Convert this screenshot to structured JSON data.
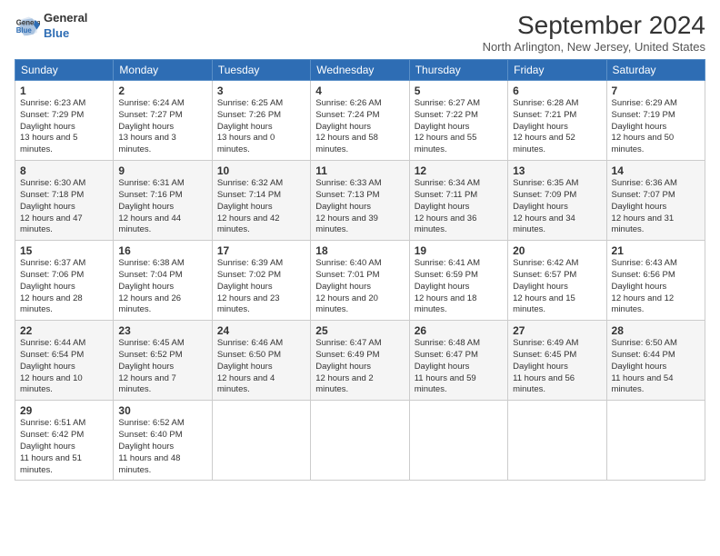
{
  "header": {
    "logo_line1": "General",
    "logo_line2": "Blue",
    "month": "September 2024",
    "location": "North Arlington, New Jersey, United States"
  },
  "days_of_week": [
    "Sunday",
    "Monday",
    "Tuesday",
    "Wednesday",
    "Thursday",
    "Friday",
    "Saturday"
  ],
  "weeks": [
    [
      {
        "day": "1",
        "sunrise": "6:23 AM",
        "sunset": "7:29 PM",
        "daylight": "13 hours and 5 minutes."
      },
      {
        "day": "2",
        "sunrise": "6:24 AM",
        "sunset": "7:27 PM",
        "daylight": "13 hours and 3 minutes."
      },
      {
        "day": "3",
        "sunrise": "6:25 AM",
        "sunset": "7:26 PM",
        "daylight": "13 hours and 0 minutes."
      },
      {
        "day": "4",
        "sunrise": "6:26 AM",
        "sunset": "7:24 PM",
        "daylight": "12 hours and 58 minutes."
      },
      {
        "day": "5",
        "sunrise": "6:27 AM",
        "sunset": "7:22 PM",
        "daylight": "12 hours and 55 minutes."
      },
      {
        "day": "6",
        "sunrise": "6:28 AM",
        "sunset": "7:21 PM",
        "daylight": "12 hours and 52 minutes."
      },
      {
        "day": "7",
        "sunrise": "6:29 AM",
        "sunset": "7:19 PM",
        "daylight": "12 hours and 50 minutes."
      }
    ],
    [
      {
        "day": "8",
        "sunrise": "6:30 AM",
        "sunset": "7:18 PM",
        "daylight": "12 hours and 47 minutes."
      },
      {
        "day": "9",
        "sunrise": "6:31 AM",
        "sunset": "7:16 PM",
        "daylight": "12 hours and 44 minutes."
      },
      {
        "day": "10",
        "sunrise": "6:32 AM",
        "sunset": "7:14 PM",
        "daylight": "12 hours and 42 minutes."
      },
      {
        "day": "11",
        "sunrise": "6:33 AM",
        "sunset": "7:13 PM",
        "daylight": "12 hours and 39 minutes."
      },
      {
        "day": "12",
        "sunrise": "6:34 AM",
        "sunset": "7:11 PM",
        "daylight": "12 hours and 36 minutes."
      },
      {
        "day": "13",
        "sunrise": "6:35 AM",
        "sunset": "7:09 PM",
        "daylight": "12 hours and 34 minutes."
      },
      {
        "day": "14",
        "sunrise": "6:36 AM",
        "sunset": "7:07 PM",
        "daylight": "12 hours and 31 minutes."
      }
    ],
    [
      {
        "day": "15",
        "sunrise": "6:37 AM",
        "sunset": "7:06 PM",
        "daylight": "12 hours and 28 minutes."
      },
      {
        "day": "16",
        "sunrise": "6:38 AM",
        "sunset": "7:04 PM",
        "daylight": "12 hours and 26 minutes."
      },
      {
        "day": "17",
        "sunrise": "6:39 AM",
        "sunset": "7:02 PM",
        "daylight": "12 hours and 23 minutes."
      },
      {
        "day": "18",
        "sunrise": "6:40 AM",
        "sunset": "7:01 PM",
        "daylight": "12 hours and 20 minutes."
      },
      {
        "day": "19",
        "sunrise": "6:41 AM",
        "sunset": "6:59 PM",
        "daylight": "12 hours and 18 minutes."
      },
      {
        "day": "20",
        "sunrise": "6:42 AM",
        "sunset": "6:57 PM",
        "daylight": "12 hours and 15 minutes."
      },
      {
        "day": "21",
        "sunrise": "6:43 AM",
        "sunset": "6:56 PM",
        "daylight": "12 hours and 12 minutes."
      }
    ],
    [
      {
        "day": "22",
        "sunrise": "6:44 AM",
        "sunset": "6:54 PM",
        "daylight": "12 hours and 10 minutes."
      },
      {
        "day": "23",
        "sunrise": "6:45 AM",
        "sunset": "6:52 PM",
        "daylight": "12 hours and 7 minutes."
      },
      {
        "day": "24",
        "sunrise": "6:46 AM",
        "sunset": "6:50 PM",
        "daylight": "12 hours and 4 minutes."
      },
      {
        "day": "25",
        "sunrise": "6:47 AM",
        "sunset": "6:49 PM",
        "daylight": "12 hours and 2 minutes."
      },
      {
        "day": "26",
        "sunrise": "6:48 AM",
        "sunset": "6:47 PM",
        "daylight": "11 hours and 59 minutes."
      },
      {
        "day": "27",
        "sunrise": "6:49 AM",
        "sunset": "6:45 PM",
        "daylight": "11 hours and 56 minutes."
      },
      {
        "day": "28",
        "sunrise": "6:50 AM",
        "sunset": "6:44 PM",
        "daylight": "11 hours and 54 minutes."
      }
    ],
    [
      {
        "day": "29",
        "sunrise": "6:51 AM",
        "sunset": "6:42 PM",
        "daylight": "11 hours and 51 minutes."
      },
      {
        "day": "30",
        "sunrise": "6:52 AM",
        "sunset": "6:40 PM",
        "daylight": "11 hours and 48 minutes."
      },
      null,
      null,
      null,
      null,
      null
    ]
  ]
}
